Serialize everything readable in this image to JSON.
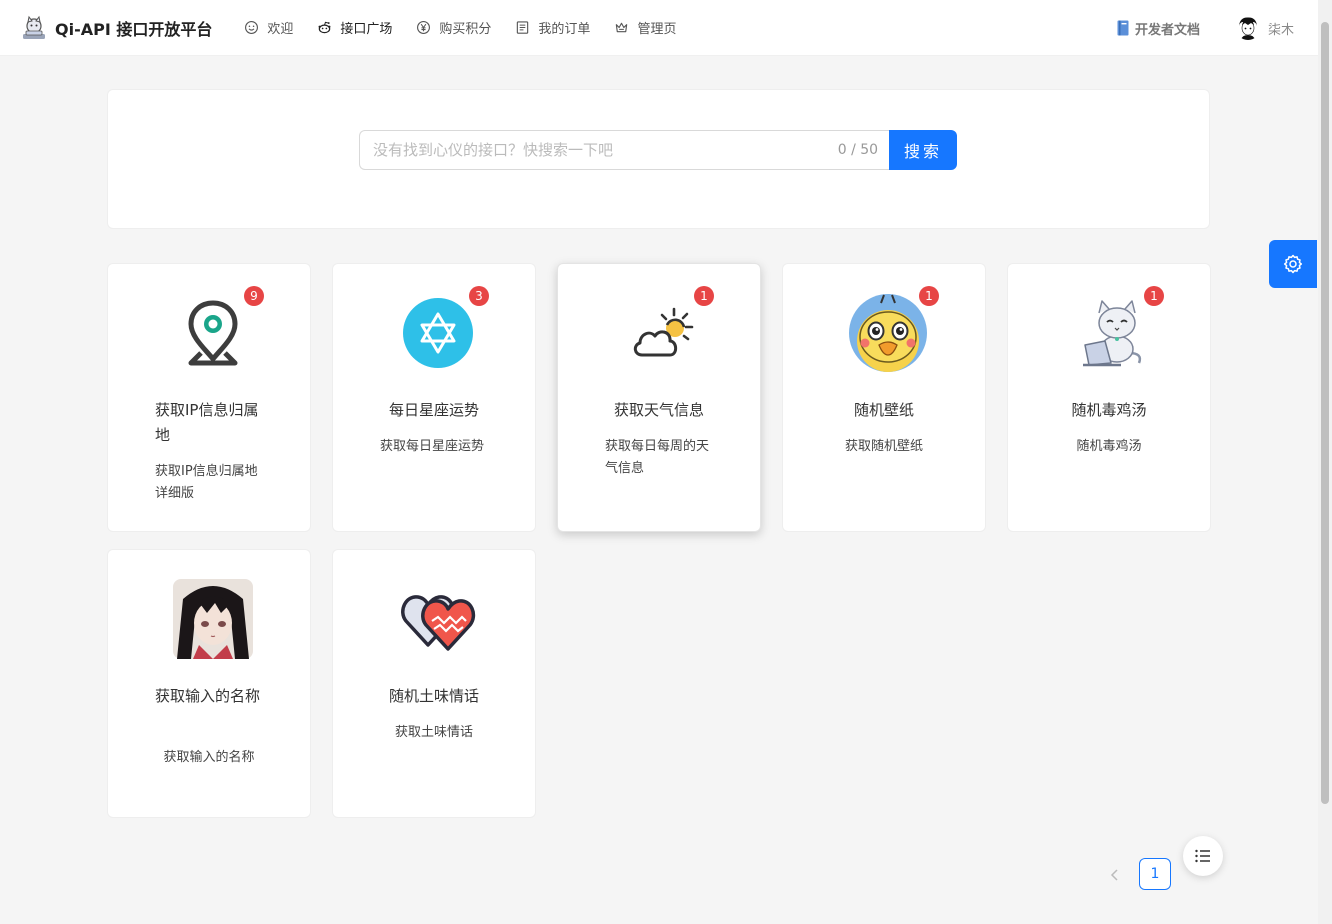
{
  "app": {
    "title": "Qi-API 接口开放平台"
  },
  "nav": {
    "items": [
      {
        "label": "欢迎",
        "icon": "smile-icon"
      },
      {
        "label": "接口广场",
        "icon": "reddit-icon",
        "active": true
      },
      {
        "label": "购买积分",
        "icon": "yuan-circle-icon"
      },
      {
        "label": "我的订单",
        "icon": "profile-icon"
      },
      {
        "label": "管理页",
        "icon": "crown-icon"
      }
    ]
  },
  "header": {
    "doc_label": "开发者文档",
    "user_name": "柒木"
  },
  "search": {
    "placeholder": "没有找到心仪的接口？快搜索一下吧",
    "count": "0 / 50",
    "button_label": "搜索"
  },
  "cards": [
    {
      "title": "获取IP信息归属地",
      "desc": "获取IP信息归属地详细版",
      "badge": "9",
      "icon": "location-pin-icon"
    },
    {
      "title": "每日星座运势",
      "desc": "获取每日星座运势",
      "badge": "3",
      "icon": "star-of-david-icon"
    },
    {
      "title": "获取天气信息",
      "desc": "获取每日每周的天气信息",
      "badge": "1",
      "icon": "weather-icon"
    },
    {
      "title": "随机壁纸",
      "desc": "获取随机壁纸",
      "badge": "1",
      "icon": "duck-avatar-icon"
    },
    {
      "title": "随机毒鸡汤",
      "desc": "随机毒鸡汤",
      "badge": "1",
      "icon": "cat-laptop-icon"
    },
    {
      "title": "获取输入的名称",
      "desc": "获取输入的名称",
      "icon": "anime-girl-image"
    },
    {
      "title": "随机土味情话",
      "desc": "获取土味情话",
      "icon": "hearts-icon"
    }
  ],
  "pagination": {
    "current": "1"
  },
  "colors": {
    "primary": "#1677ff",
    "badge": "#e74545"
  }
}
